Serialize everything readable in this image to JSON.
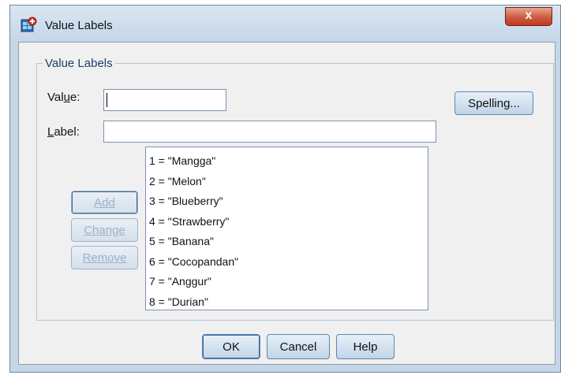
{
  "window": {
    "title": "Value Labels",
    "close_label": "x"
  },
  "group": {
    "legend": "Value Labels"
  },
  "fields": {
    "value_label": "Value:",
    "value": "",
    "label_label": "Label:",
    "label": ""
  },
  "buttons": {
    "spelling": "Spelling...",
    "add": "Add",
    "change": "Change",
    "remove": "Remove",
    "ok": "OK",
    "cancel": "Cancel",
    "help": "Help"
  },
  "value_labels": [
    "1 = \"Mangga\"",
    "2 = \"Melon\"",
    "3 = \"Blueberry\"",
    "4 = \"Strawberry\"",
    "5 = \"Banana\"",
    "6 = \"Cocopandan\"",
    "7 = \"Anggur\"",
    "8 = \"Durian\""
  ],
  "colors": {
    "frame": "#c7d6e6",
    "client": "#f0f0f0",
    "close": "#c94f33",
    "button": "#c1d4e7",
    "disabled_text": "#9fb0c3"
  }
}
